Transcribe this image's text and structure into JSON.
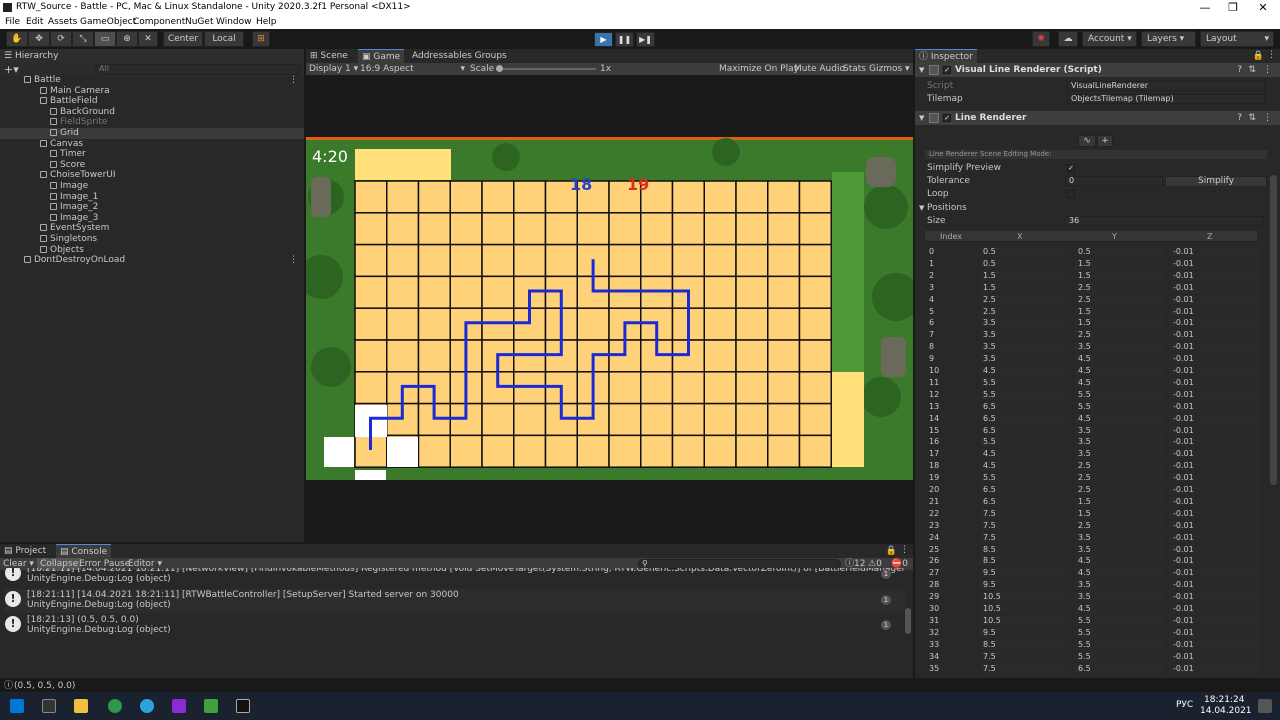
{
  "window": {
    "title": "RTW_Source - Battle - PC, Mac & Linux Standalone - Unity 2020.3.2f1 Personal <DX11>"
  },
  "menu": [
    "File",
    "Edit",
    "Assets",
    "GameObject",
    "Component",
    "NuGet",
    "Window",
    "Help"
  ],
  "toolbar": {
    "center": "Center",
    "local": "Local",
    "account": "Account",
    "layers": "Layers",
    "layout": "Layout"
  },
  "hierarchy": {
    "tab": "Hierarchy",
    "search_placeholder": "All",
    "rows": [
      {
        "label": "Battle",
        "depth": 0,
        "scene": true
      },
      {
        "label": "Main Camera",
        "depth": 1
      },
      {
        "label": "BattleField",
        "depth": 1
      },
      {
        "label": "BackGround",
        "depth": 2
      },
      {
        "label": "FieldSprite",
        "depth": 2,
        "dim": true
      },
      {
        "label": "Grid",
        "depth": 2,
        "sel": true
      },
      {
        "label": "Canvas",
        "depth": 1
      },
      {
        "label": "Timer",
        "depth": 2
      },
      {
        "label": "Score",
        "depth": 2
      },
      {
        "label": "ChoiseTowerUI",
        "depth": 1
      },
      {
        "label": "Image",
        "depth": 2
      },
      {
        "label": "Image_1",
        "depth": 2
      },
      {
        "label": "Image_2",
        "depth": 2
      },
      {
        "label": "Image_3",
        "depth": 2
      },
      {
        "label": "EventSystem",
        "depth": 1
      },
      {
        "label": "Singletons",
        "depth": 1
      },
      {
        "label": "Objects",
        "depth": 1
      },
      {
        "label": "DontDestroyOnLoad",
        "depth": 0,
        "scene": true
      }
    ]
  },
  "viewtabs": {
    "scene": "Scene",
    "game": "Game",
    "addressables": "Addressables Groups"
  },
  "game": {
    "display": "Display 1",
    "aspect": "16:9 Aspect",
    "scale_label": "Scale",
    "scale_value": "1x",
    "maximize": "Maximize On Play",
    "mute": "Mute Audio",
    "stats": "Stats",
    "gizmos": "Gizmos",
    "timer": "4:20",
    "score_blue": "18",
    "score_red": "19",
    "colors": {
      "tile": "#ffd27a",
      "grass": "#3c8a2a",
      "path": "#1a2bd6",
      "blue": "#2244cc",
      "red": "#e32c1c"
    }
  },
  "inspector": {
    "tab": "Inspector",
    "vlr_title": "Visual Line Renderer (Script)",
    "script_label": "Script",
    "script_value": "VisualLineRenderer",
    "tilemap_label": "Tilemap",
    "tilemap_value": "ObjectsTilemap (Tilemap)",
    "lr_title": "Line Renderer",
    "edit_mode": "Line Renderer Scene Editing Mode:",
    "simplify_preview": "Simplify Preview",
    "tolerance_label": "Tolerance",
    "tolerance_value": "0",
    "simplify_btn": "Simplify",
    "loop_label": "Loop",
    "positions_label": "Positions",
    "size_label": "Size",
    "size_value": "36",
    "col_index": "Index",
    "col_x": "X",
    "col_y": "Y",
    "col_z": "Z",
    "positions": [
      [
        "0",
        "0.5",
        "0.5",
        "-0.01"
      ],
      [
        "1",
        "0.5",
        "1.5",
        "-0.01"
      ],
      [
        "2",
        "1.5",
        "1.5",
        "-0.01"
      ],
      [
        "3",
        "1.5",
        "2.5",
        "-0.01"
      ],
      [
        "4",
        "2.5",
        "2.5",
        "-0.01"
      ],
      [
        "5",
        "2.5",
        "1.5",
        "-0.01"
      ],
      [
        "6",
        "3.5",
        "1.5",
        "-0.01"
      ],
      [
        "7",
        "3.5",
        "2.5",
        "-0.01"
      ],
      [
        "8",
        "3.5",
        "3.5",
        "-0.01"
      ],
      [
        "9",
        "3.5",
        "4.5",
        "-0.01"
      ],
      [
        "10",
        "4.5",
        "4.5",
        "-0.01"
      ],
      [
        "11",
        "5.5",
        "4.5",
        "-0.01"
      ],
      [
        "12",
        "5.5",
        "5.5",
        "-0.01"
      ],
      [
        "13",
        "6.5",
        "5.5",
        "-0.01"
      ],
      [
        "14",
        "6.5",
        "4.5",
        "-0.01"
      ],
      [
        "15",
        "6.5",
        "3.5",
        "-0.01"
      ],
      [
        "16",
        "5.5",
        "3.5",
        "-0.01"
      ],
      [
        "17",
        "4.5",
        "3.5",
        "-0.01"
      ],
      [
        "18",
        "4.5",
        "2.5",
        "-0.01"
      ],
      [
        "19",
        "5.5",
        "2.5",
        "-0.01"
      ],
      [
        "20",
        "6.5",
        "2.5",
        "-0.01"
      ],
      [
        "21",
        "6.5",
        "1.5",
        "-0.01"
      ],
      [
        "22",
        "7.5",
        "1.5",
        "-0.01"
      ],
      [
        "23",
        "7.5",
        "2.5",
        "-0.01"
      ],
      [
        "24",
        "7.5",
        "3.5",
        "-0.01"
      ],
      [
        "25",
        "8.5",
        "3.5",
        "-0.01"
      ],
      [
        "26",
        "8.5",
        "4.5",
        "-0.01"
      ],
      [
        "27",
        "9.5",
        "4.5",
        "-0.01"
      ],
      [
        "28",
        "9.5",
        "3.5",
        "-0.01"
      ],
      [
        "29",
        "10.5",
        "3.5",
        "-0.01"
      ],
      [
        "30",
        "10.5",
        "4.5",
        "-0.01"
      ],
      [
        "31",
        "10.5",
        "5.5",
        "-0.01"
      ],
      [
        "32",
        "9.5",
        "5.5",
        "-0.01"
      ],
      [
        "33",
        "8.5",
        "5.5",
        "-0.01"
      ],
      [
        "34",
        "7.5",
        "5.5",
        "-0.01"
      ],
      [
        "35",
        "7.5",
        "6.5",
        "-0.01"
      ]
    ]
  },
  "console": {
    "project_tab": "Project",
    "console_tab": "Console",
    "clear": "Clear",
    "collapse": "Collapse",
    "error_pause": "Error Pause",
    "editor": "Editor",
    "count_info": "12",
    "count_warn": "0",
    "count_err": "0",
    "entries": [
      {
        "line1": "[18:21:11] [14.04.2021 18:21:11] [NetworkView] [FindInvokableMethods] Registered method [Void SetMoveTarget(System.String, RTW.Generic.Scripts.Data.VectorZeroInt)] of [BattleFieldManager:FSetMoveTarget]",
        "line2": "UnityEngine.Debug:Log (object)",
        "count": "1"
      },
      {
        "line1": "[18:21:11] [14.04.2021 18:21:11] [RTWBattleController] [SetupServer] Started server on 30000",
        "line2": "UnityEngine.Debug:Log (object)",
        "count": "1"
      },
      {
        "line1": "[18:21:13] (0.5, 0.5, 0.0)",
        "line2": "UnityEngine.Debug:Log (object)",
        "count": "1"
      }
    ]
  },
  "statusbar": {
    "text": "(0.5, 0.5, 0.0)"
  },
  "taskbar": {
    "lang": "РУС",
    "time": "18:21:24",
    "date": "14.04.2021"
  }
}
